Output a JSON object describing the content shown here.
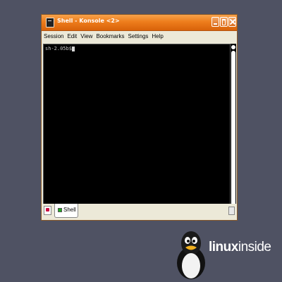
{
  "window": {
    "title": "Shell - Konsole <2>"
  },
  "menubar": {
    "items": [
      "Session",
      "Edit",
      "View",
      "Bookmarks",
      "Settings",
      "Help"
    ]
  },
  "terminal": {
    "prompt": "sh-2.05b$"
  },
  "tabbar": {
    "tabs": [
      {
        "label": "Shell"
      }
    ]
  },
  "brand": {
    "bold": "linux",
    "light": "inside"
  },
  "icons": {
    "app": "terminal-icon",
    "new_tab": "new-tab-icon",
    "tab": "shell-icon",
    "close_tab": "close-tab-icon",
    "logo": "penguin-logo"
  },
  "colors": {
    "background": "#4f5263",
    "titlebar": "#ee7d1c",
    "terminal_bg": "#000000",
    "terminal_fg": "#c8c8c8"
  }
}
